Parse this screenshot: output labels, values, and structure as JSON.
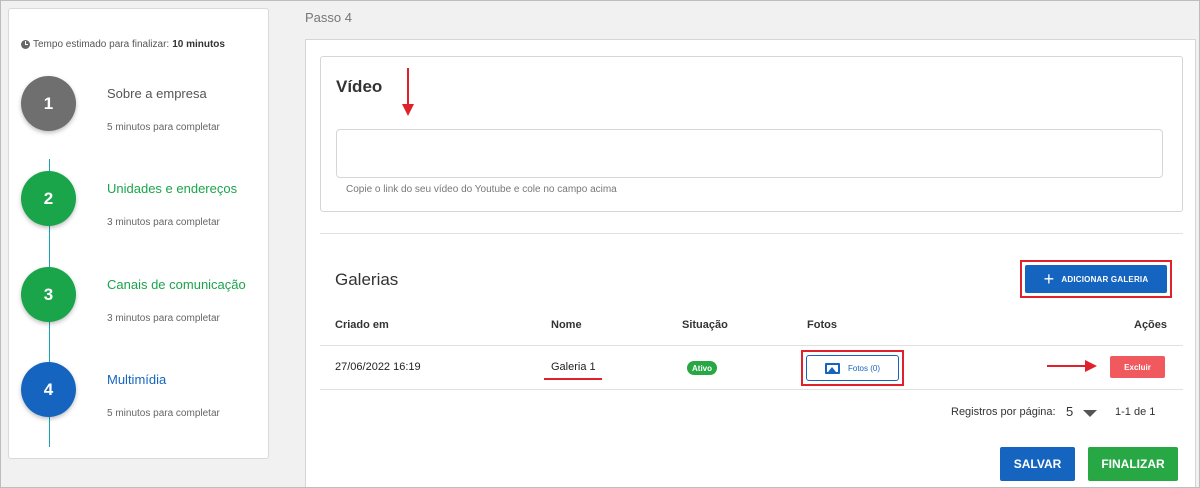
{
  "sidebar": {
    "time_label": "Tempo estimado para finalizar:",
    "time_value": "10 minutos",
    "steps": [
      {
        "number": "1",
        "label": "Sobre a empresa",
        "sub": "5 minutos para completar",
        "color": "#6f6f6f",
        "label_color": "#555555"
      },
      {
        "number": "2",
        "label": "Unidades e endereços",
        "sub": "3 minutos para completar",
        "color": "#1aa54a",
        "label_color": "#1aa54a"
      },
      {
        "number": "3",
        "label": "Canais de comunicação",
        "sub": "3 minutos para completar",
        "color": "#1aa54a",
        "label_color": "#1aa54a"
      },
      {
        "number": "4",
        "label": "Multimídia",
        "sub": "5 minutos para completar",
        "color": "#1565c0",
        "label_color": "#1565c0"
      }
    ]
  },
  "main": {
    "step_title": "Passo 4",
    "video": {
      "title": "Vídeo",
      "input_value": "",
      "help": "Copie o link do seu vídeo do Youtube e cole no campo acima"
    },
    "galleries": {
      "title": "Galerias",
      "add_button": "ADICIONAR GALERIA",
      "columns": [
        "Criado em",
        "Nome",
        "Situação",
        "Fotos",
        "Ações"
      ],
      "rows": [
        {
          "created": "27/06/2022 16:19",
          "name": "Galeria 1",
          "status": "Ativo",
          "photos": "Fotos (0)",
          "action": "Excluir"
        }
      ],
      "pagination": {
        "label": "Registros por página:",
        "per_page": "5",
        "range": "1-1 de 1"
      }
    },
    "buttons": {
      "save": "SALVAR",
      "finish": "FINALIZAR"
    }
  },
  "colors": {
    "primary": "#1565c0",
    "success": "#28a745",
    "danger": "#f05a5e",
    "highlight": "#e0202a"
  }
}
